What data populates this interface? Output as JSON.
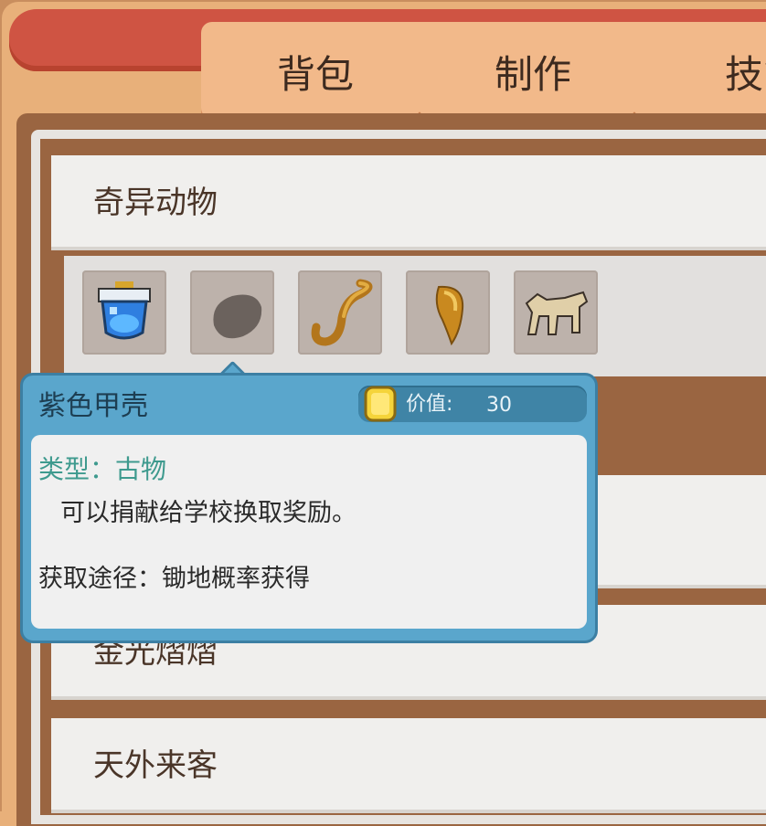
{
  "tabs": [
    "背包",
    "制作",
    "技能"
  ],
  "categories": [
    {
      "label": "奇异动物"
    },
    {
      "label": "金光熠熠"
    },
    {
      "label": "天外来客"
    }
  ],
  "items": [
    {
      "icon": "blue-potion-jar-icon"
    },
    {
      "icon": "purple-shell-icon"
    },
    {
      "icon": "golden-hook-icon"
    },
    {
      "icon": "golden-fang-icon"
    },
    {
      "icon": "fossil-creature-icon"
    }
  ],
  "tooltip": {
    "title": "紫色甲壳",
    "value_label": "价值:",
    "value": "30",
    "type": "类型：古物",
    "description": "可以捐献给学校换取奖励。",
    "source": "获取途径：锄地概率获得"
  },
  "colors": {
    "title_banner": "#cf5443",
    "tab_strip": "#f2b98a",
    "tooltip_border": "#3c7fa3",
    "tooltip_header": "#5aa6cc",
    "type_text": "#3e9a8e"
  }
}
